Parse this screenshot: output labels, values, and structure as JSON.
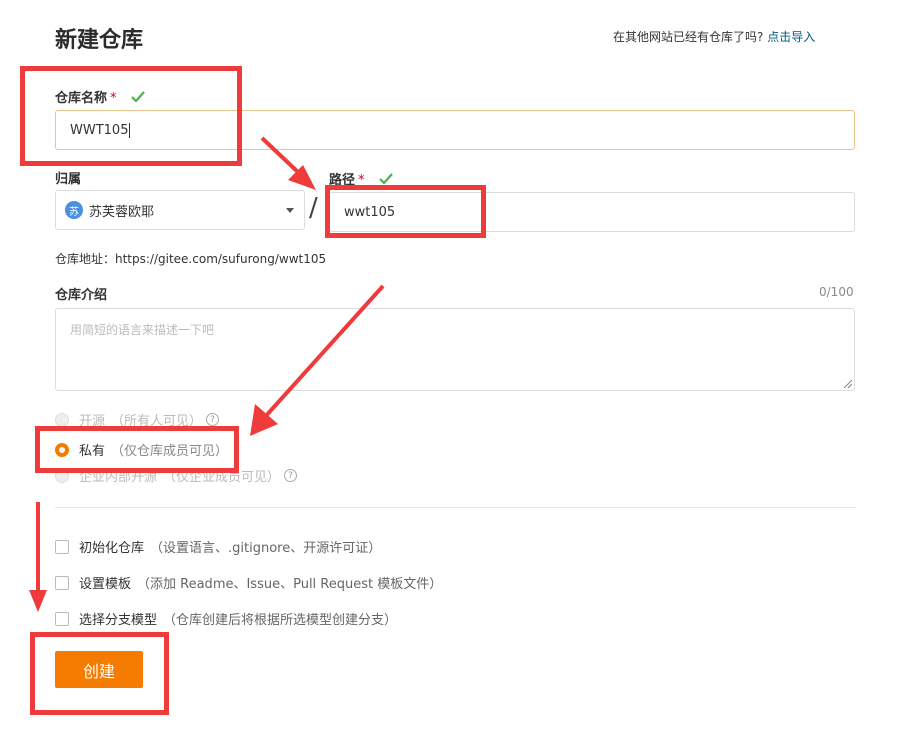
{
  "header": {
    "title": "新建仓库",
    "import_hint": "在其他网站已经有仓库了吗?",
    "import_link": "点击导入"
  },
  "repo_name": {
    "label": "仓库名称",
    "required_mark": "*",
    "value": "WWT105"
  },
  "owner": {
    "label": "归属",
    "avatar_text": "苏",
    "value": "苏芙蓉欧耶"
  },
  "separator": "/",
  "path": {
    "label": "路径",
    "required_mark": "*",
    "value": "wwt105"
  },
  "repo_address": "仓库地址：https://gitee.com/sufurong/wwt105",
  "description": {
    "label": "仓库介绍",
    "counter": "0/100",
    "placeholder": "用简短的语言来描述一下吧"
  },
  "visibility": {
    "options": [
      {
        "label": "开源",
        "note": "（所有人可见）",
        "state": "disabled"
      },
      {
        "label": "私有",
        "note": "（仅仓库成员可见）",
        "state": "checked"
      },
      {
        "label": "企业内部开源",
        "note": "（仅企业成员可见）",
        "state": "disabled"
      }
    ]
  },
  "options": [
    {
      "label": "初始化仓库",
      "note": "（设置语言、.gitignore、开源许可证）"
    },
    {
      "label": "设置模板",
      "note": "（添加 Readme、Issue、Pull Request 模板文件）"
    },
    {
      "label": "选择分支模型",
      "note": "（仓库创建后将根据所选模型创建分支）"
    }
  ],
  "submit_label": "创建",
  "colors": {
    "accent": "#f57c00",
    "link": "#005980",
    "check_green": "#4caf50",
    "annotation_red": "#ef3b3b"
  }
}
